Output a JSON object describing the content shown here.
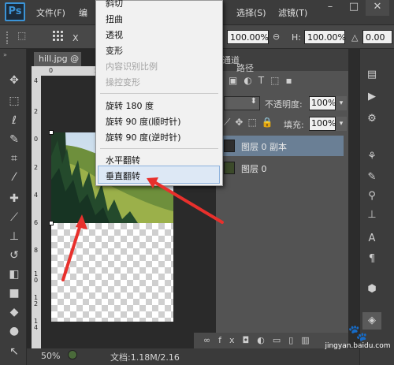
{
  "app": {
    "logo": "Ps"
  },
  "menubar": {
    "items": [
      "文件(F)",
      "编",
      "选择(S)",
      "滤镜(T)"
    ],
    "window_buttons": [
      "–",
      "□",
      "✕"
    ]
  },
  "options": {
    "x_label": "X",
    "w_value": "100.00%",
    "h_label": "H:",
    "h_value": "100.00%",
    "angle_label": "△",
    "angle_value": "0.00"
  },
  "document": {
    "tab_title": "hill.jpg @",
    "ruler_top": [
      "0",
      "5",
      "1",
      "0"
    ],
    "ruler_left": [
      "4",
      "2",
      "0",
      "2",
      "4",
      "6",
      "8",
      "1 0",
      "1 2",
      "1 4"
    ]
  },
  "status": {
    "zoom": "50%",
    "doc_info": "文档:1.18M/2.16"
  },
  "panels": {
    "tabs": [
      "通道",
      "路径"
    ],
    "opacity_label": "不透明度:",
    "opacity_value": "100%",
    "fill_label": "填充:",
    "fill_value": "100%",
    "layers": [
      {
        "name": "图层 0 副本",
        "selected": true
      },
      {
        "name": "图层 0",
        "selected": false
      }
    ],
    "footer_icons": [
      "link-icon",
      "fx-icon",
      "mask-icon",
      "adjustment-icon",
      "group-icon",
      "new-layer-icon",
      "trash-icon"
    ]
  },
  "dropdown": {
    "items": [
      {
        "label": "斜切",
        "disabled": false
      },
      {
        "label": "扭曲",
        "disabled": false
      },
      {
        "label": "透视",
        "disabled": false
      },
      {
        "label": "变形",
        "disabled": false
      },
      {
        "label": "内容识别比例",
        "disabled": true
      },
      {
        "label": "操控变形",
        "disabled": true
      },
      {
        "label": "旋转 180 度",
        "disabled": false
      },
      {
        "label": "旋转 90 度(顺时针)",
        "disabled": false
      },
      {
        "label": "旋转 90 度(逆时针)",
        "disabled": false
      },
      {
        "label": "水平翻转",
        "disabled": false
      },
      {
        "label": "垂直翻转",
        "disabled": false,
        "highlighted": true
      }
    ]
  },
  "watermark": {
    "site": "jingyan.baidu.com"
  },
  "colors": {
    "accent_arrow": "#e8302c",
    "ps_blue": "#3b93d6",
    "menu_bg": "#f1f1f1",
    "highlight": "#dde8f5"
  }
}
